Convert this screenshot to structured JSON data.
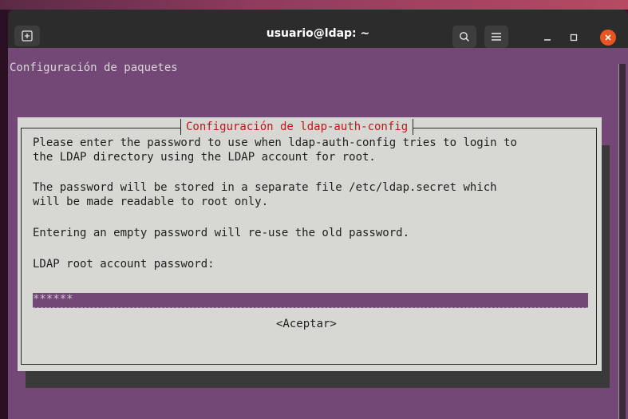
{
  "window": {
    "title": "usuario@ldap: ~"
  },
  "terminal": {
    "backtitle": "Configuración de paquetes"
  },
  "dialog": {
    "title": "Configuración de ldap-auth-config",
    "lines": [
      "Please enter the password to use when ldap-auth-config tries to login to",
      "the LDAP directory using the LDAP account for root.",
      "The password will be stored in a separate file /etc/ldap.secret which",
      "will be made readable to root only.",
      "Entering an empty password will re-use the old password.",
      "LDAP root account password:"
    ],
    "password_value": "******",
    "ok_label": "<Aceptar>"
  },
  "colors": {
    "terminal_bg": "#734776",
    "dialog_bg": "#d7d7d3",
    "dialog_title": "#c0161a",
    "close_button": "#e95420"
  },
  "icons": {
    "new_tab": "new-tab-icon",
    "search": "search-icon",
    "menu": "hamburger-menu-icon",
    "minimize": "minimize-icon",
    "maximize": "maximize-icon",
    "close": "close-icon"
  }
}
